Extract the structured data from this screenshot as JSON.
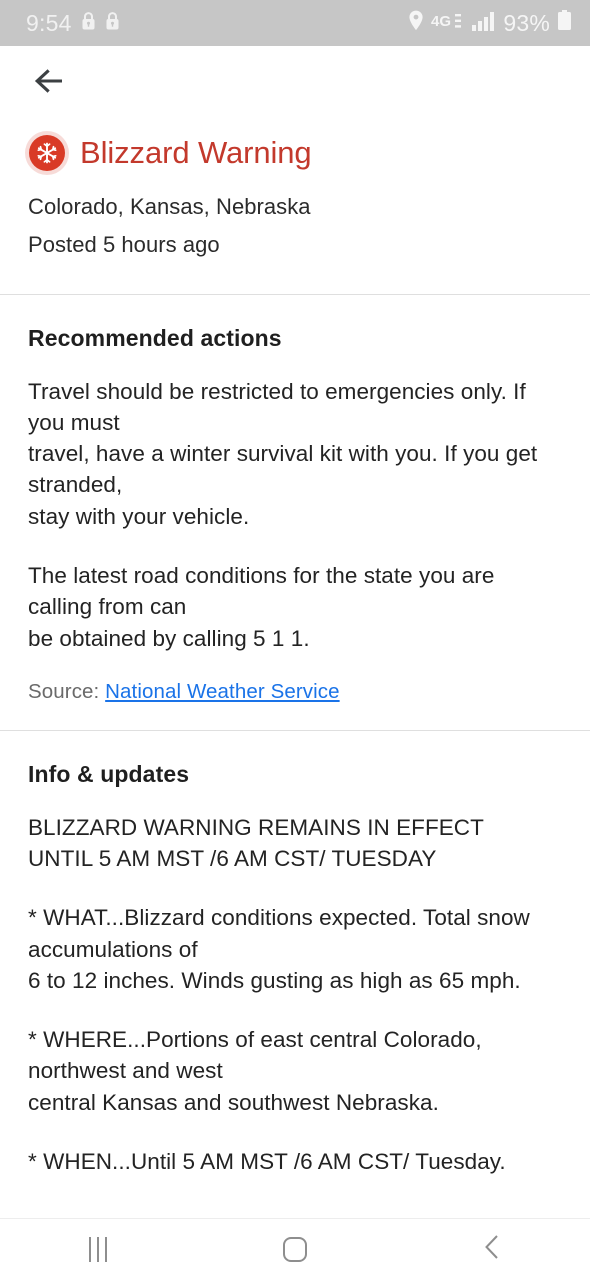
{
  "status_bar": {
    "clock": "9:54",
    "battery_percent": "93%",
    "network": "4G",
    "icons": [
      "lock-icon",
      "lock-icon",
      "location-pin-icon",
      "network-4g-icon",
      "signal-bars-icon",
      "battery-icon"
    ]
  },
  "app_bar": {
    "back_label": "Back"
  },
  "alert": {
    "title": "Blizzard Warning",
    "icon": "snowflake-alert-icon",
    "icon_color": "#d93a26",
    "title_color": "#c3392c",
    "regions": "Colorado, Kansas, Nebraska",
    "posted": "Posted 5 hours ago"
  },
  "recommended": {
    "heading": "Recommended actions",
    "paragraphs": [
      "Travel should be restricted to emergencies only. If you must\ntravel, have a winter survival kit with you. If you get stranded,\nstay with your vehicle.",
      "The latest road conditions for the state you are calling from can\nbe obtained by calling 5 1 1."
    ],
    "source_label": "Source:",
    "source_link": "National Weather Service",
    "source_link_color": "#1a73e8"
  },
  "info": {
    "heading": "Info & updates",
    "paragraphs": [
      "BLIZZARD WARNING REMAINS IN EFFECT\nUNTIL 5 AM MST /6 AM CST/ TUESDAY",
      "* WHAT...Blizzard conditions expected. Total snow accumulations of\n6 to 12 inches. Winds gusting as high as 65 mph.",
      "* WHERE...Portions of east central Colorado, northwest and west\ncentral Kansas and southwest Nebraska.",
      "* WHEN...Until 5 AM MST /6 AM CST/ Tuesday."
    ]
  },
  "nav_bar": {
    "recents_label": "Recents",
    "home_label": "Home",
    "back_label": "Back"
  }
}
